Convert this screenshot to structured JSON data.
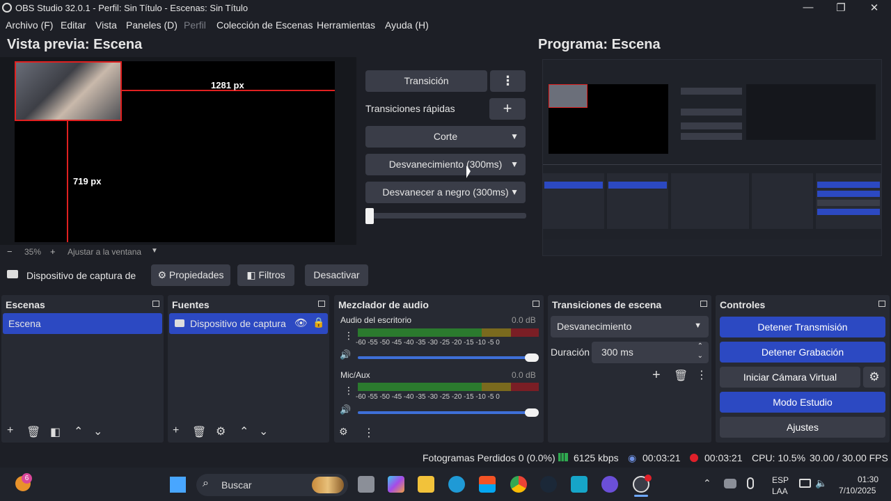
{
  "window": {
    "title": "OBS Studio 32.0.1 - Perfil: Sin Título - Escenas: Sin Título",
    "minimize": "—",
    "maximize": "❐",
    "close": "✕"
  },
  "menu": [
    "Archivo (F)",
    "Editar",
    "Vista",
    "Paneles (D)",
    "Perfil",
    "Colección de Escenas",
    "Herramientas",
    "Ayuda (H)"
  ],
  "preview": {
    "title": "Vista previa: Escena",
    "width_label": "1281 px",
    "height_label": "719 px",
    "zoom_minus": "−",
    "zoom": "35%",
    "zoom_plus": "+",
    "fit": "Ajustar a la ventana"
  },
  "program": {
    "title": "Programa: Escena"
  },
  "transition_panel": {
    "transition": "Transición",
    "quick": "Transiciones rápidas",
    "cut": "Corte",
    "fade": "Desvanecimiento (300ms)",
    "fade_black": "Desvanecer a negro (300ms)",
    "tbar": 0.0
  },
  "source_toolbar": {
    "source_name": "Dispositivo de captura de v",
    "properties": "Propiedades",
    "filters": "Filtros",
    "deactivate": "Desactivar"
  },
  "scenes": {
    "title": "Escenas",
    "items": [
      "Escena"
    ]
  },
  "sources": {
    "title": "Fuentes",
    "items": [
      "Dispositivo de captura d"
    ]
  },
  "mixer": {
    "title": "Mezclador de audio",
    "channels": [
      {
        "name": "Audio del escritorio",
        "db": "0.0 dB"
      },
      {
        "name": "Mic/Aux",
        "db": "0.0 dB"
      }
    ],
    "scale": "-60 -55 -50 -45 -40 -35 -30 -25 -20 -15 -10 -5 0"
  },
  "transitions": {
    "title": "Transiciones de escena",
    "selected": "Desvanecimiento",
    "duration_label": "Duración",
    "duration": "300 ms"
  },
  "controls": {
    "title": "Controles",
    "stop_stream": "Detener Transmisión",
    "stop_record": "Detener Grabación",
    "virtual_cam": "Iniciar Cámara Virtual",
    "studio_mode": "Modo Estudio",
    "settings": "Ajustes"
  },
  "status": {
    "dropped": "Fotogramas Perdidos 0 (0.0%)",
    "bitrate": "6125 kbps",
    "stream_time": "00:03:21",
    "rec_time": "00:03:21",
    "cpu": "CPU: 10.5%",
    "fps": "30.00 / 30.00 FPS"
  },
  "taskbar": {
    "search": "Buscar",
    "badge": "6",
    "lang": "ESP",
    "layout": "LAA",
    "time": "01:30",
    "date": "7/10/2025"
  },
  "colors": {
    "accent": "#2c49c2",
    "bg": "#1d1f26",
    "dock": "#272a33",
    "button": "#3a3d48",
    "selection": "#ff2020"
  }
}
